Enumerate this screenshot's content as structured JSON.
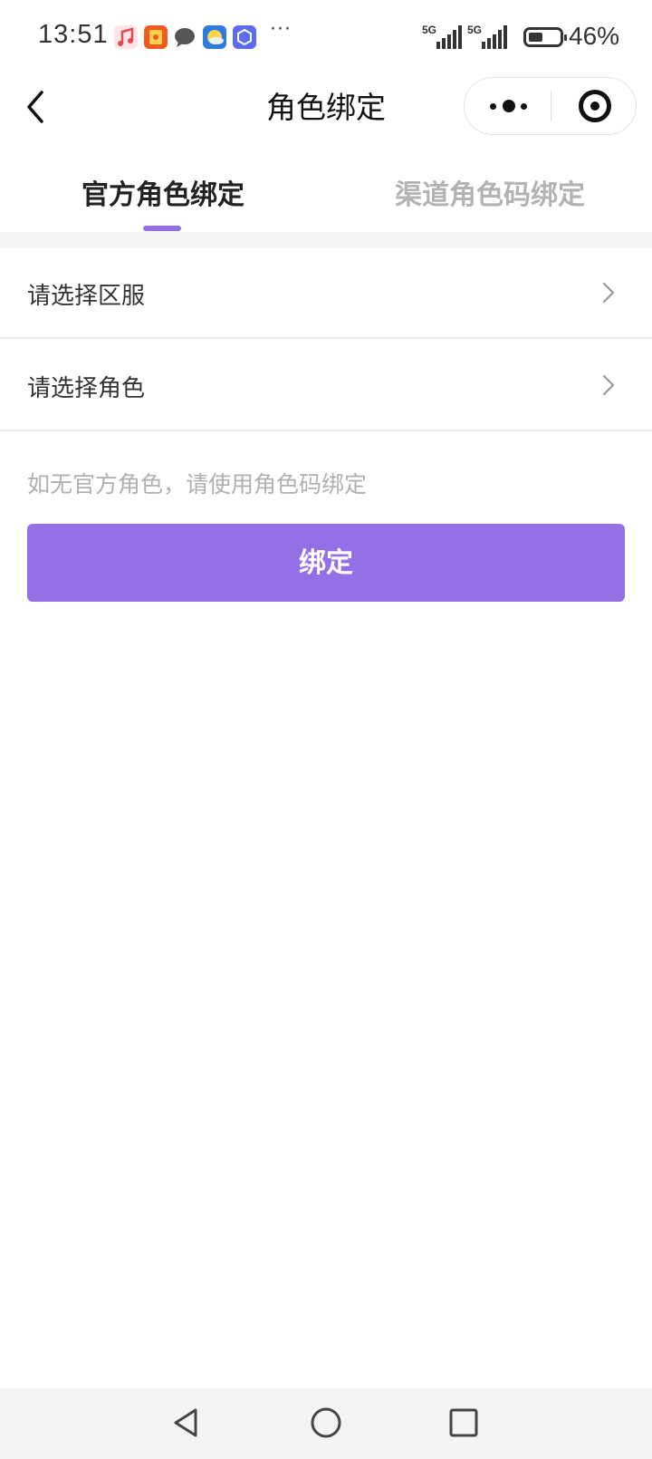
{
  "status_bar": {
    "time": "13:51",
    "network_1": "5G",
    "network_2": "5G",
    "battery_percent": "46%",
    "battery_level": 0.46,
    "more_notifications": "···",
    "notification_icons": [
      "music-app-icon",
      "red-envelope-app-icon",
      "chat-bubble-icon",
      "weather-app-icon",
      "blue-app-icon"
    ]
  },
  "nav": {
    "title": "角色绑定"
  },
  "tabs": [
    {
      "label": "官方角色绑定",
      "active": true
    },
    {
      "label": "渠道角色码绑定",
      "active": false
    }
  ],
  "form": {
    "server_label": "请选择区服",
    "role_label": "请选择角色",
    "hint": "如无官方角色，请使用角色码绑定",
    "submit_label": "绑定"
  },
  "colors": {
    "accent": "#9370e6",
    "tab_inactive": "#b3b3b3",
    "hint": "#b0b0b0"
  }
}
